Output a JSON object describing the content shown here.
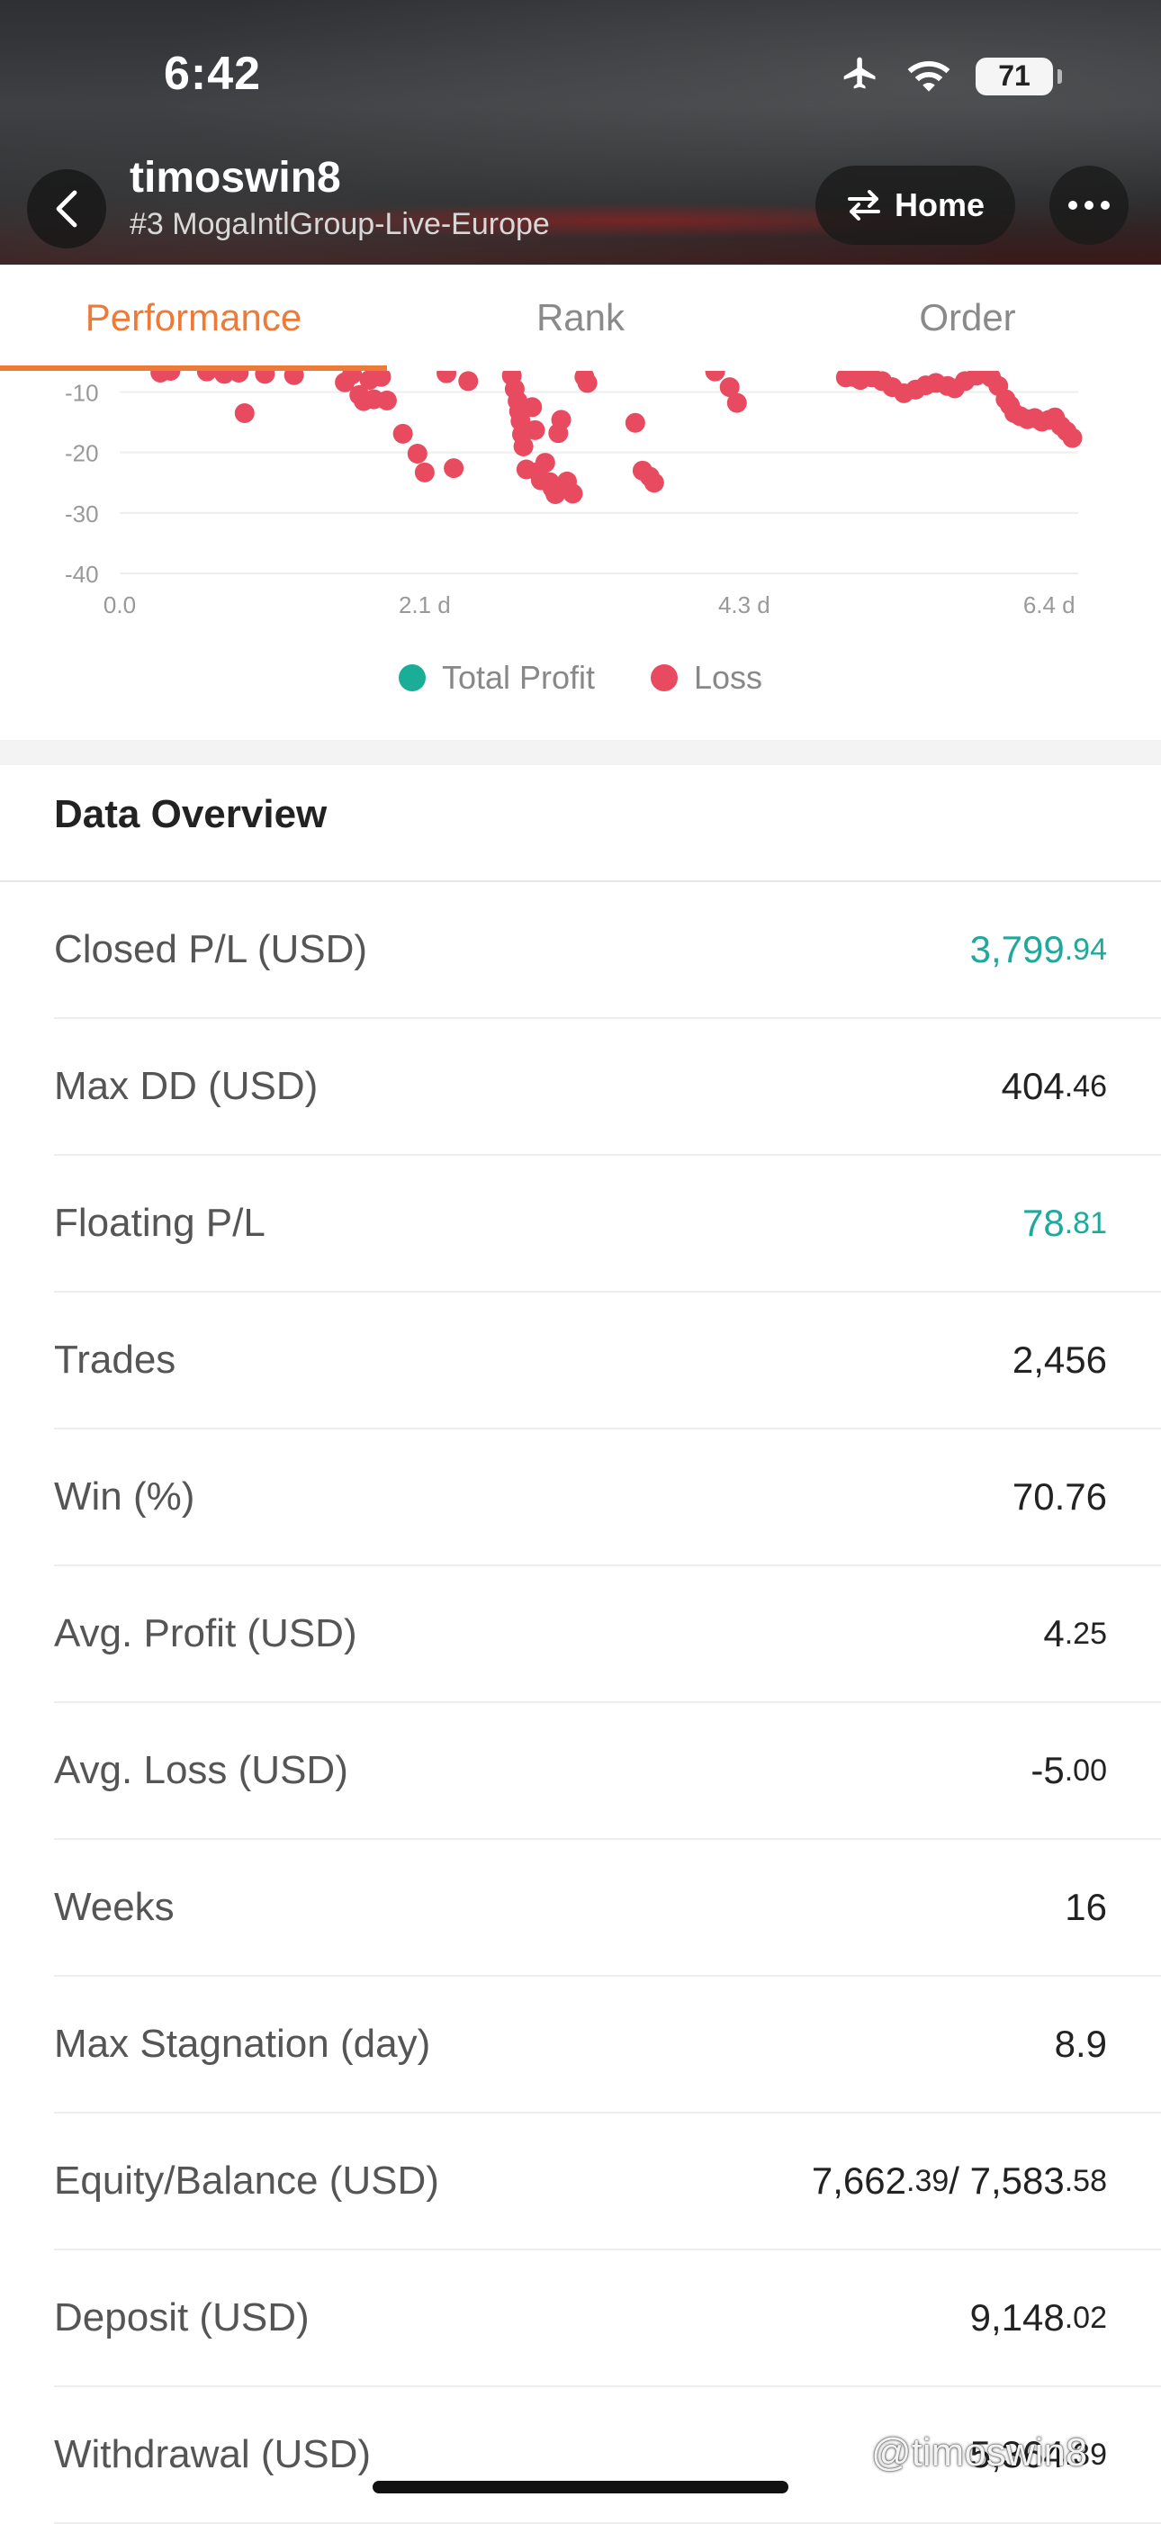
{
  "status_bar": {
    "time": "6:42",
    "battery": "71"
  },
  "header": {
    "title": "timoswin8",
    "subtitle": "#3 MogaIntlGroup-Live-Europe",
    "home_label": "Home"
  },
  "tabs": [
    {
      "label": "Performance",
      "active": true
    },
    {
      "label": "Rank",
      "active": false
    },
    {
      "label": "Order",
      "active": false
    }
  ],
  "chart_data": {
    "type": "scatter",
    "x_ticks": [
      "0.0",
      "2.1 d",
      "4.3 d",
      "6.4 d"
    ],
    "y_ticks": [
      "-10",
      "-20",
      "-30",
      "-40"
    ],
    "xlim": [
      0,
      6.6
    ],
    "ylim": [
      -40,
      -6.5
    ],
    "series": [
      {
        "name": "Loss",
        "color": "#e84a5f",
        "points": [
          [
            0.28,
            -6.8
          ],
          [
            0.35,
            -6.5
          ],
          [
            0.6,
            -6.6
          ],
          [
            0.72,
            -7.0
          ],
          [
            0.82,
            -6.8
          ],
          [
            0.86,
            -13.5
          ],
          [
            1.0,
            -7.0
          ],
          [
            1.2,
            -7.2
          ],
          [
            1.55,
            -8.4
          ],
          [
            1.6,
            -7.1
          ],
          [
            1.65,
            -10.5
          ],
          [
            1.68,
            -11.5
          ],
          [
            1.72,
            -8.0
          ],
          [
            1.75,
            -11.2
          ],
          [
            1.8,
            -7.5
          ],
          [
            1.84,
            -11.4
          ],
          [
            1.95,
            -16.9
          ],
          [
            2.05,
            -20.2
          ],
          [
            2.1,
            -23.3
          ],
          [
            2.25,
            -6.9
          ],
          [
            2.3,
            -22.6
          ],
          [
            2.4,
            -8.2
          ],
          [
            2.7,
            -7.3
          ],
          [
            2.72,
            -9.5
          ],
          [
            2.74,
            -11.5
          ],
          [
            2.75,
            -13.2
          ],
          [
            2.76,
            -14.8
          ],
          [
            2.77,
            -17.0
          ],
          [
            2.78,
            -19.0
          ],
          [
            2.8,
            -22.8
          ],
          [
            2.84,
            -12.5
          ],
          [
            2.86,
            -16.3
          ],
          [
            2.88,
            -23.2
          ],
          [
            2.9,
            -24.6
          ],
          [
            2.93,
            -21.7
          ],
          [
            2.96,
            -24.9
          ],
          [
            2.98,
            -25.9
          ],
          [
            3.0,
            -26.9
          ],
          [
            3.02,
            -16.8
          ],
          [
            3.04,
            -14.6
          ],
          [
            3.08,
            -24.8
          ],
          [
            3.12,
            -26.8
          ],
          [
            3.2,
            -7.5
          ],
          [
            3.22,
            -8.5
          ],
          [
            3.55,
            -15.1
          ],
          [
            3.6,
            -23.0
          ],
          [
            3.65,
            -24.0
          ],
          [
            3.68,
            -25.0
          ],
          [
            4.1,
            -6.6
          ],
          [
            4.2,
            -9.2
          ],
          [
            4.25,
            -11.8
          ],
          [
            5.0,
            -7.6
          ],
          [
            5.05,
            -7.5
          ],
          [
            5.1,
            -8.0
          ],
          [
            5.18,
            -7.6
          ],
          [
            5.25,
            -8.2
          ],
          [
            5.32,
            -9.2
          ],
          [
            5.4,
            -10.2
          ],
          [
            5.48,
            -9.6
          ],
          [
            5.55,
            -8.9
          ],
          [
            5.62,
            -8.5
          ],
          [
            5.7,
            -9.0
          ],
          [
            5.75,
            -9.4
          ],
          [
            5.82,
            -8.2
          ],
          [
            5.9,
            -7.3
          ],
          [
            5.96,
            -6.8
          ],
          [
            6.0,
            -7.6
          ],
          [
            6.05,
            -9.0
          ],
          [
            6.1,
            -11.2
          ],
          [
            6.13,
            -12.2
          ],
          [
            6.16,
            -13.5
          ],
          [
            6.2,
            -14.0
          ],
          [
            6.25,
            -14.5
          ],
          [
            6.3,
            -14.3
          ],
          [
            6.35,
            -14.9
          ],
          [
            6.4,
            -14.6
          ],
          [
            6.44,
            -14.2
          ],
          [
            6.48,
            -15.6
          ],
          [
            6.52,
            -16.5
          ],
          [
            6.56,
            -17.6
          ]
        ]
      }
    ],
    "legend": [
      {
        "name": "Total Profit",
        "color": "#1aae96"
      },
      {
        "name": "Loss",
        "color": "#e84a5f"
      }
    ],
    "legend_placement": "bottom-center",
    "grid": true
  },
  "overview": {
    "title": "Data Overview",
    "rows": [
      {
        "label": "Closed P/L (USD)",
        "int": "3,799",
        "dec": ".94",
        "green": true
      },
      {
        "label": "Max DD (USD)",
        "int": "404",
        "dec": ".46",
        "green": false
      },
      {
        "label": "Floating P/L",
        "int": "78",
        "dec": ".81",
        "green": true
      },
      {
        "label": "Trades",
        "int": "2,456",
        "dec": "",
        "green": false
      },
      {
        "label": "Win (%)",
        "int": "70.76",
        "dec": "",
        "green": false
      },
      {
        "label": "Avg. Profit (USD)",
        "int": "4",
        "dec": ".25",
        "green": false
      },
      {
        "label": "Avg. Loss (USD)",
        "int": "-5",
        "dec": ".00",
        "green": false
      },
      {
        "label": "Weeks",
        "int": "16",
        "dec": "",
        "green": false
      },
      {
        "label": "Max Stagnation (day)",
        "int": "8.9",
        "dec": "",
        "green": false
      },
      {
        "label": "Equity/Balance (USD)",
        "int": "7,662",
        "dec": ".39",
        "int2": " / 7,583",
        "dec2": ".58",
        "green": false
      },
      {
        "label": "Deposit (USD)",
        "int": "9,148",
        "dec": ".02",
        "green": false
      },
      {
        "label": "Withdrawal (USD)",
        "int": "5,364",
        "dec": ".39",
        "green": false
      }
    ]
  },
  "watermark": "@timoswin8"
}
